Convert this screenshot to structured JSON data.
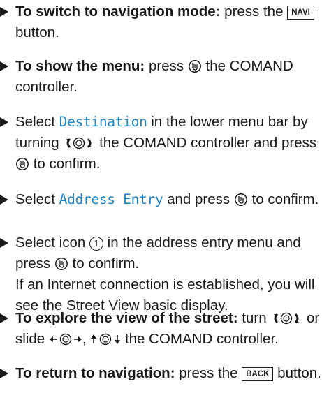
{
  "steps": [
    {
      "bold": "To switch to navigation mode:",
      "pre": " press the ",
      "key": "NAVI",
      "post": " button."
    },
    {
      "bold": "To show the menu:",
      "pre": " press ",
      "post": " the COMAND controller."
    },
    {
      "pre": "Select ",
      "hl": "Destination",
      "mid": " in the lower menu bar by turning ",
      "post": " the COMAND controller and press ",
      "post2": " to confirm."
    },
    {
      "pre": "Select ",
      "hl": "Address Entry",
      "mid": " and press ",
      "post": " to confirm."
    },
    {
      "pre": "Select icon ",
      "num": "1",
      "mid": " in the address entry menu and press ",
      "post": " to confirm.",
      "note": "If an Internet connection is established, you will see the Street View basic display."
    },
    {
      "bold": "To explore the view of the street:",
      "pre": " turn ",
      "mid": " or slide ",
      "comma": ", ",
      "post": " the COMAND controller."
    },
    {
      "bold": "To return to navigation:",
      "pre": " press the ",
      "key": "BACK",
      "post": " button."
    }
  ],
  "icons": {
    "press": "controller-press-icon",
    "turn": "controller-turn-icon",
    "slide_lr": "controller-slide-left-right-icon",
    "slide_ud": "controller-slide-up-down-icon"
  },
  "colors": {
    "highlight": "#1b86c8",
    "text": "#1a1a1a"
  }
}
